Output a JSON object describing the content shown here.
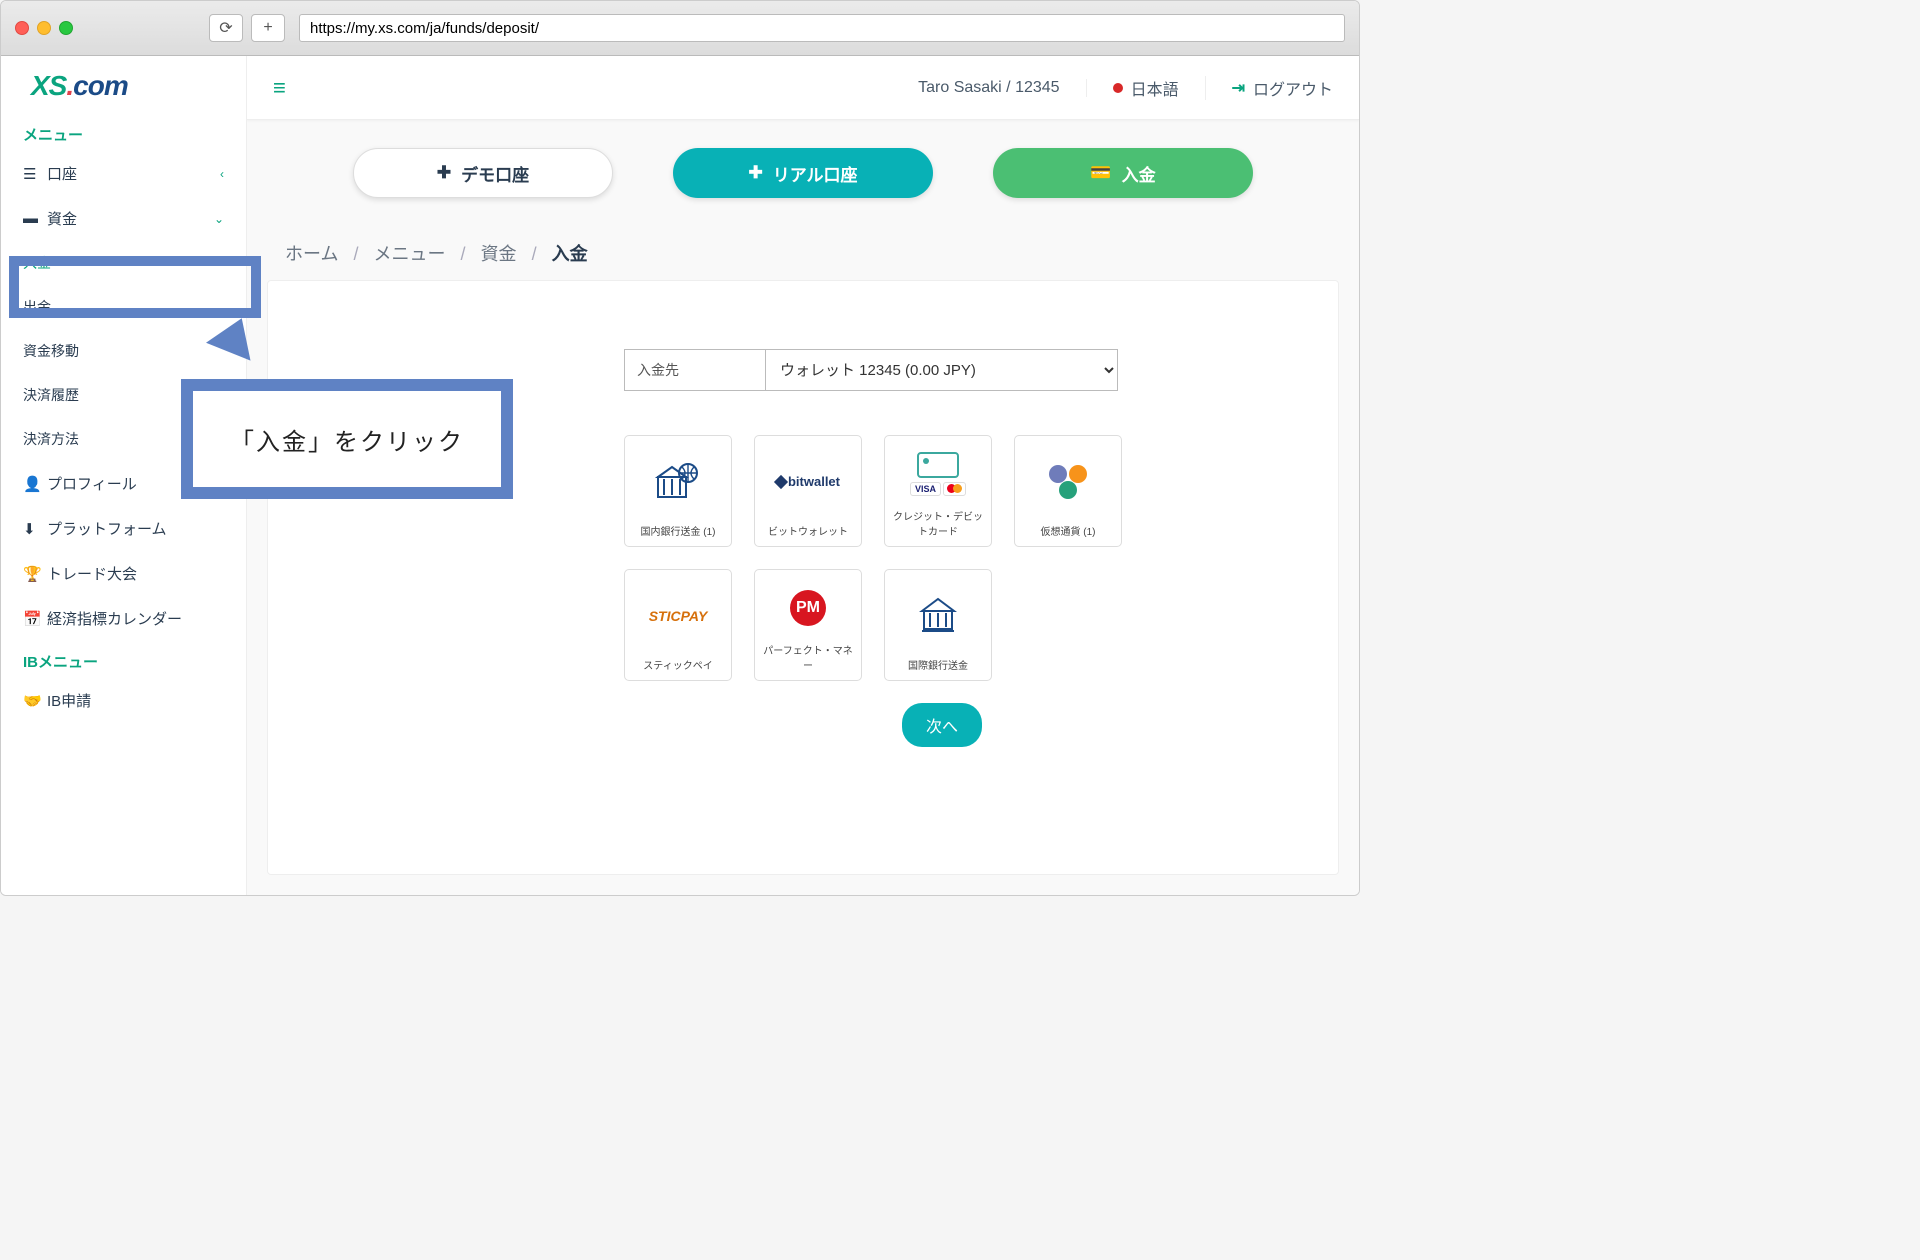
{
  "browser": {
    "url": "https://my.xs.com/ja/funds/deposit/"
  },
  "logo": {
    "p1": "XS",
    "p2": ".",
    "p3": "com"
  },
  "sidebar": {
    "section_menu": "メニュー",
    "accounts": "口座",
    "funds": "資金",
    "deposit": "入金",
    "withdraw": "出金",
    "transfer": "資金移動",
    "history": "決済履歴",
    "methods": "決済方法",
    "profile": "プロフィール",
    "platform": "プラットフォーム",
    "contest": "トレード大会",
    "calendar": "経済指標カレンダー",
    "section_ib": "IBメニュー",
    "ib_apply": "IB申請"
  },
  "callout": {
    "text": "「入金」をクリック"
  },
  "topbar": {
    "user": "Taro Sasaki / 12345",
    "lang": "日本語",
    "logout": "ログアウト"
  },
  "actions": {
    "demo": "デモ口座",
    "real": "リアル口座",
    "deposit": "入金"
  },
  "breadcrumb": {
    "home": "ホーム",
    "menu": "メニュー",
    "funds": "資金",
    "current": "入金"
  },
  "dest": {
    "label": "入金先",
    "selected": "ウォレット 12345 (0.00 JPY)"
  },
  "methods": {
    "bank": "国内銀行送金 (1)",
    "bitwallet_logo": "bitwallet",
    "bitwallet": "ビットウォレット",
    "visa_text": "VISA",
    "card": "クレジット・デビットカード",
    "crypto": "仮想通貨 (1)",
    "sticpay_logo": "STICPAY",
    "sticpay": "スティックペイ",
    "pm_logo": "PM",
    "pm": "パーフェクト・マネー",
    "intl": "国際銀行送金"
  },
  "buttons": {
    "next": "次へ"
  }
}
